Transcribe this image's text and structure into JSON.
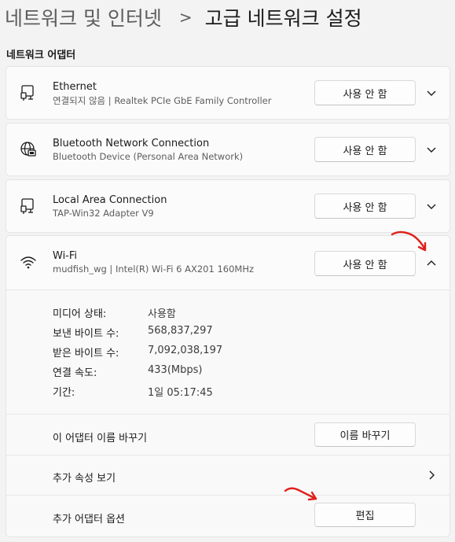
{
  "breadcrumb": {
    "parent": "네트워크 및 인터넷",
    "separator": ">",
    "current": "고급 네트워크 설정"
  },
  "section_title": "네트워크 어댑터",
  "adapters": [
    {
      "title": "Ethernet",
      "subtitle": "연결되지 않음 | Realtek PCIe GbE Family Controller",
      "button": "사용 안 함",
      "icon": "ethernet-icon",
      "chevron": "chevron-down-icon"
    },
    {
      "title": "Bluetooth Network Connection",
      "subtitle": "Bluetooth Device (Personal Area Network)",
      "button": "사용 안 함",
      "icon": "globe-network-icon",
      "chevron": "chevron-down-icon"
    },
    {
      "title": "Local Area Connection",
      "subtitle": "TAP-Win32 Adapter V9",
      "button": "사용 안 함",
      "icon": "ethernet-icon",
      "chevron": "chevron-down-icon"
    }
  ],
  "wifi": {
    "title": "Wi-Fi",
    "subtitle": "mudfish_wg | Intel(R) Wi-Fi 6 AX201 160MHz",
    "button": "사용 안 함",
    "icon": "wifi-icon",
    "chevron": "chevron-up-icon",
    "properties": [
      {
        "label": "미디어 상태:",
        "value": "사용함"
      },
      {
        "label": "보낸 바이트 수:",
        "value": "568,837,297"
      },
      {
        "label": "받은 바이트 수:",
        "value": "7,092,038,197"
      },
      {
        "label": "연결 속도:",
        "value": "433(Mbps)"
      },
      {
        "label": "기간:",
        "value": "1일 05:17:45"
      }
    ],
    "rename_label": "이 어댑터 이름 바꾸기",
    "rename_button": "이름 바꾸기",
    "more_props_label": "추가 속성 보기",
    "more_options_label": "추가 어댑터 옵션",
    "edit_button": "편집"
  },
  "colors": {
    "background": "#f3f3f3",
    "card": "#fbfbfb",
    "annotation_arrow": "#e0201c"
  }
}
